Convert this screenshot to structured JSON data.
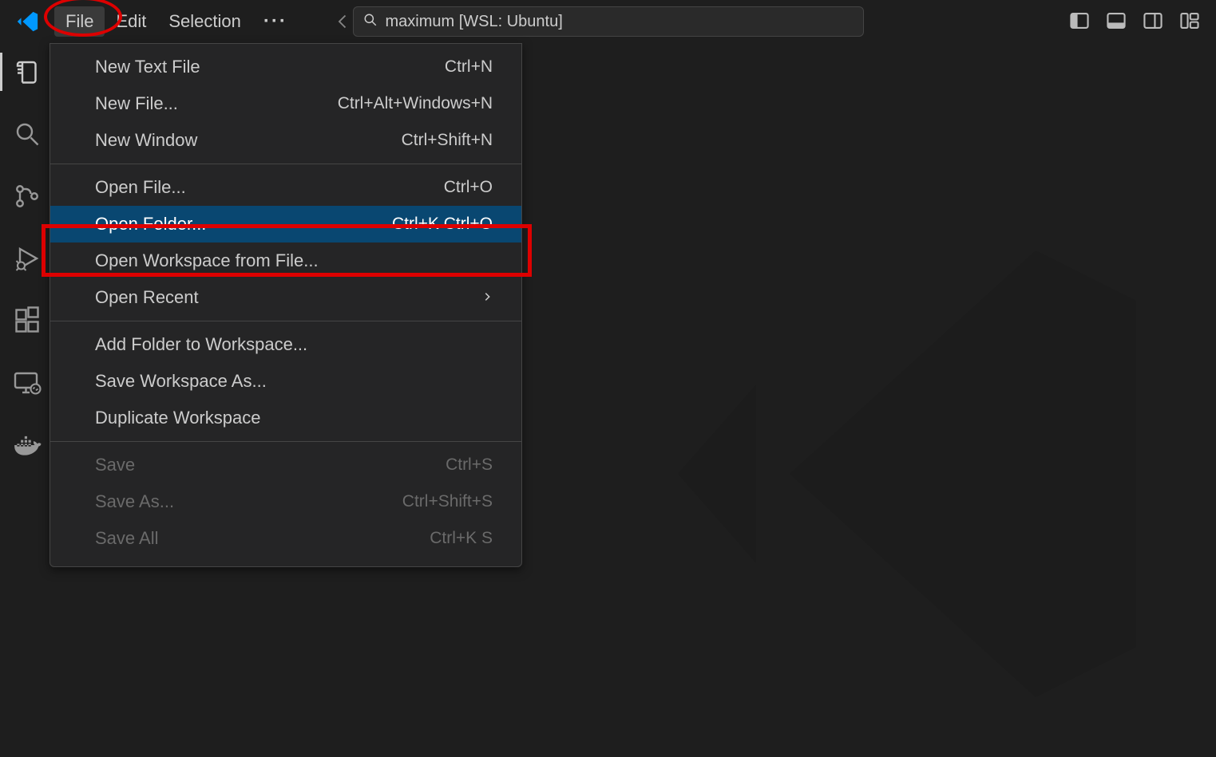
{
  "menubar": {
    "file": "File",
    "edit": "Edit",
    "selection": "Selection"
  },
  "search": {
    "text": "maximum [WSL: Ubuntu]"
  },
  "dropdown": {
    "groups": [
      [
        {
          "label": "New Text File",
          "shortcut": "Ctrl+N",
          "submenu": false,
          "disabled": false,
          "selected": false
        },
        {
          "label": "New File...",
          "shortcut": "Ctrl+Alt+Windows+N",
          "submenu": false,
          "disabled": false,
          "selected": false
        },
        {
          "label": "New Window",
          "shortcut": "Ctrl+Shift+N",
          "submenu": false,
          "disabled": false,
          "selected": false
        }
      ],
      [
        {
          "label": "Open File...",
          "shortcut": "Ctrl+O",
          "submenu": false,
          "disabled": false,
          "selected": false
        },
        {
          "label": "Open Folder...",
          "shortcut": "Ctrl+K Ctrl+O",
          "submenu": false,
          "disabled": false,
          "selected": true
        },
        {
          "label": "Open Workspace from File...",
          "shortcut": "",
          "submenu": false,
          "disabled": false,
          "selected": false
        },
        {
          "label": "Open Recent",
          "shortcut": "",
          "submenu": true,
          "disabled": false,
          "selected": false
        }
      ],
      [
        {
          "label": "Add Folder to Workspace...",
          "shortcut": "",
          "submenu": false,
          "disabled": false,
          "selected": false
        },
        {
          "label": "Save Workspace As...",
          "shortcut": "",
          "submenu": false,
          "disabled": false,
          "selected": false
        },
        {
          "label": "Duplicate Workspace",
          "shortcut": "",
          "submenu": false,
          "disabled": false,
          "selected": false
        }
      ],
      [
        {
          "label": "Save",
          "shortcut": "Ctrl+S",
          "submenu": false,
          "disabled": true,
          "selected": false
        },
        {
          "label": "Save As...",
          "shortcut": "Ctrl+Shift+S",
          "submenu": false,
          "disabled": true,
          "selected": false
        },
        {
          "label": "Save All",
          "shortcut": "Ctrl+K S",
          "submenu": false,
          "disabled": true,
          "selected": false
        }
      ]
    ]
  }
}
